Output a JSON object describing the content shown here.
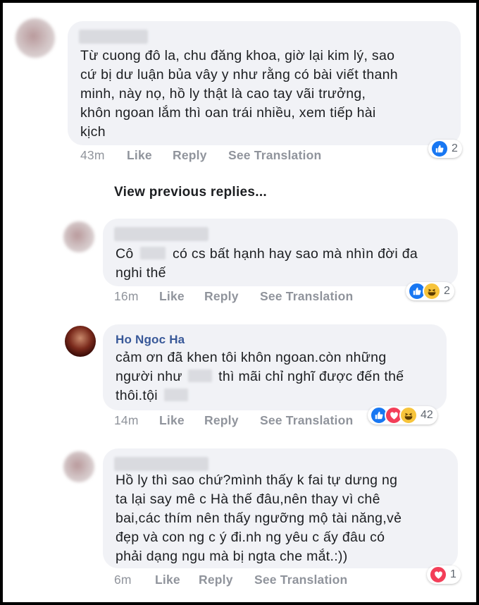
{
  "view_previous_replies": "View previous replies...",
  "comments": [
    {
      "lines": [
        "Từ cuong đô la, chu đăng khoa, giờ lại kim lý, sao",
        "cứ bị dư luận bủa vây y như rằng có bài viết thanh",
        "minh, này nọ, hồ ly thật là cao tay vãi trưởng,",
        "khôn ngoan lắm thì oan trái nhiều, xem tiếp hài",
        "kịch"
      ],
      "time": "43m",
      "like": "Like",
      "reply": "Reply",
      "translate": "See Translation",
      "reactions": [
        "like"
      ],
      "reaction_count": "2"
    },
    {
      "lines_a": [
        "Cô",
        "có cs bất hạnh hay sao mà nhìn đời đa"
      ],
      "lines_b": "nghi thế",
      "time": "16m",
      "like": "Like",
      "reply": "Reply",
      "translate": "See Translation",
      "reactions": [
        "like",
        "haha"
      ],
      "reaction_count": "2"
    },
    {
      "author": "Ho Ngoc Ha",
      "line1": "cảm ơn đã khen tôi khôn ngoan.còn những",
      "line2a": "người như",
      "line2b": "thì mãi chỉ nghĩ được đến thế",
      "line3": "thôi.tội",
      "time": "14m",
      "like": "Like",
      "reply": "Reply",
      "translate": "See Translation",
      "reactions": [
        "like",
        "love",
        "haha"
      ],
      "reaction_count": "42"
    },
    {
      "lines": [
        "Hồ ly thì sao chứ?mình thấy k fai tự dưng ng",
        "ta lại say mê c Hà thế đâu,nên thay vì chê",
        "bai,các thím nên thấy ngưỡng mộ tài năng,vẻ",
        "đẹp và con ng c ý đi.nh ng yêu c ấy đâu có",
        "phải dạng ngu mà bị ngta che mắt.:))"
      ],
      "time": "6m",
      "like": "Like",
      "reply": "Reply",
      "translate": "See Translation",
      "reactions": [
        "love"
      ],
      "reaction_count": "1"
    }
  ],
  "colors": {
    "link": "#385898",
    "meta": "#90949c",
    "bubble": "#f1f2f6",
    "like": "#1877f2",
    "love": "#f33e58",
    "haha": "#f7c43b"
  }
}
